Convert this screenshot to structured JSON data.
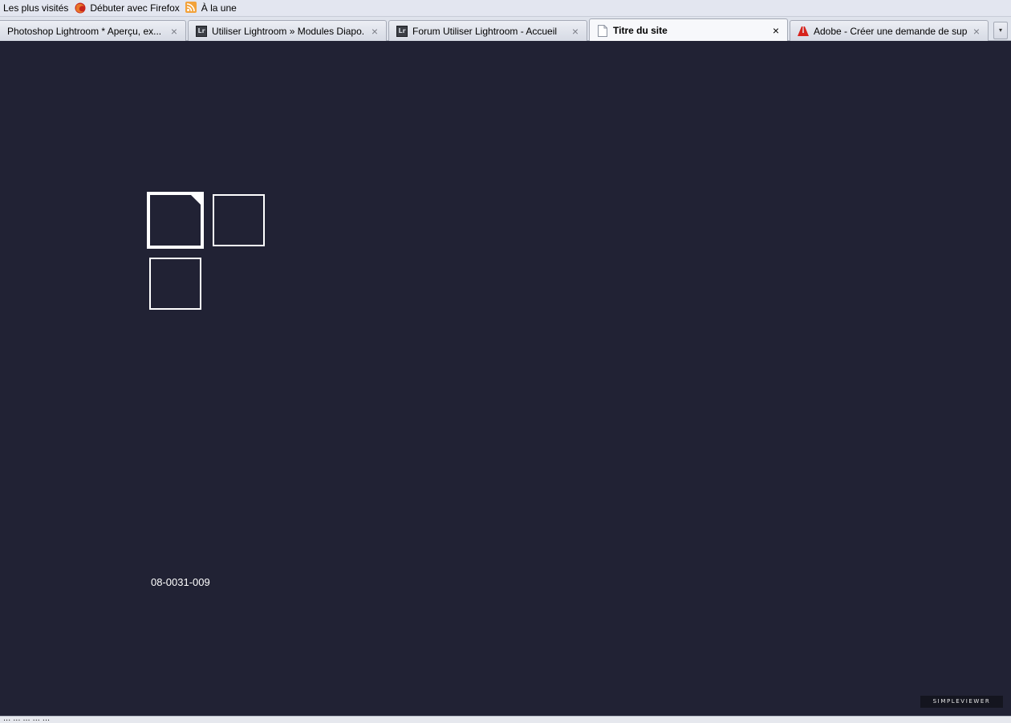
{
  "bookmarks": {
    "items": [
      {
        "label": "Les plus visités",
        "icon": ""
      },
      {
        "label": "Débuter avec Firefox",
        "icon": "firefox-icon"
      },
      {
        "label": "À la une",
        "icon": "rss-icon"
      }
    ]
  },
  "tabs": [
    {
      "label": "Photoshop Lightroom * Aperçu, ex...",
      "icon": "none"
    },
    {
      "label": "Utiliser Lightroom » Modules Diapo...",
      "icon": "lightroom-icon",
      "icon_text": "Lr"
    },
    {
      "label": "Forum Utiliser Lightroom - Accueil",
      "icon": "lightroom-icon",
      "icon_text": "Lr"
    },
    {
      "label": "Titre du site",
      "icon": "page-icon",
      "active": true
    },
    {
      "label": "Adobe - Créer une demande de sup...",
      "icon": "adobe-icon"
    }
  ],
  "tab_close_glyph": "×",
  "tab_list_glyph": "▾",
  "gallery": {
    "background": "#212234",
    "thumbnail_count": 3,
    "selected_index": 0,
    "caption": "08-0031-009",
    "brand": "SIMPLEVIEWER"
  },
  "statusbar": {
    "text": "... ... ... ... ..."
  },
  "colors": {
    "bookmark_bar": "#e3e6f0",
    "tab_strip": "#dfe3ec",
    "gallery_bg": "#212234",
    "thumb_border": "#ffffff"
  }
}
